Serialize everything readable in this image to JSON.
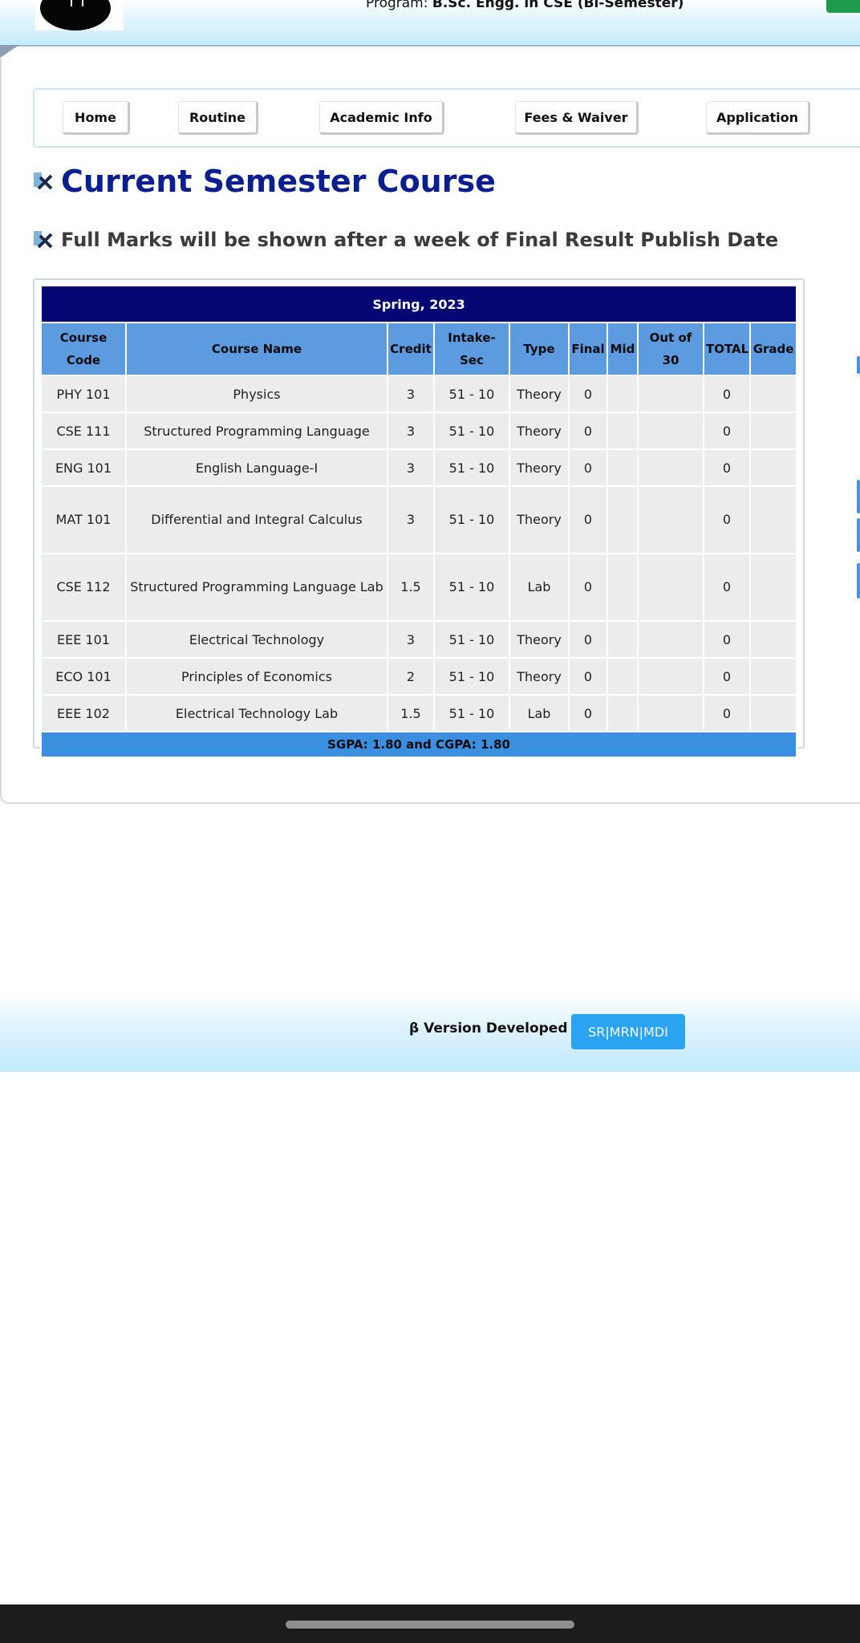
{
  "header": {
    "program_prefix": "Program:",
    "program_value": "B.Sc. Engg. in CSE (Bi-Semester)"
  },
  "nav": {
    "items": [
      {
        "label": "Home"
      },
      {
        "label": "Routine"
      },
      {
        "label": "Academic Info"
      },
      {
        "label": "Fees & Waiver"
      },
      {
        "label": "Application"
      }
    ]
  },
  "main": {
    "title": "Current Semester Course",
    "notice": "Full Marks will be shown after a week of Final Result Publish Date",
    "title_icon": "pen-ruler-icon",
    "notice_icon": "pen-ruler-icon"
  },
  "table": {
    "semester": "Spring, 2023",
    "headers": [
      "Course Code",
      "Course Name",
      "Credit",
      "Intake-Sec",
      "Type",
      "Final",
      "Mid",
      "Out of 30",
      "TOTAL",
      "Grade"
    ],
    "rows": [
      {
        "code": "PHY 101",
        "name": "Physics",
        "credit": "3",
        "intake": "51 - 10",
        "type": "Theory",
        "final": "0",
        "mid": "",
        "out30": "",
        "total": "0",
        "grade": ""
      },
      {
        "code": "CSE 111",
        "name": "Structured Programming Language",
        "credit": "3",
        "intake": "51 - 10",
        "type": "Theory",
        "final": "0",
        "mid": "",
        "out30": "",
        "total": "0",
        "grade": ""
      },
      {
        "code": "ENG 101",
        "name": "English Language-I",
        "credit": "3",
        "intake": "51 - 10",
        "type": "Theory",
        "final": "0",
        "mid": "",
        "out30": "",
        "total": "0",
        "grade": ""
      },
      {
        "code": "MAT 101",
        "name": "Differential and Integral Calculus",
        "credit": "3",
        "intake": "51 - 10",
        "type": "Theory",
        "final": "0",
        "mid": "",
        "out30": "",
        "total": "0",
        "grade": ""
      },
      {
        "code": "CSE 112",
        "name": "Structured Programming Language Lab",
        "credit": "1.5",
        "intake": "51 - 10",
        "type": "Lab",
        "final": "0",
        "mid": "",
        "out30": "",
        "total": "0",
        "grade": ""
      },
      {
        "code": "EEE 101",
        "name": "Electrical Technology",
        "credit": "3",
        "intake": "51 - 10",
        "type": "Theory",
        "final": "0",
        "mid": "",
        "out30": "",
        "total": "0",
        "grade": ""
      },
      {
        "code": "ECO 101",
        "name": "Principles of Economics",
        "credit": "2",
        "intake": "51 - 10",
        "type": "Theory",
        "final": "0",
        "mid": "",
        "out30": "",
        "total": "0",
        "grade": ""
      },
      {
        "code": "EEE 102",
        "name": "Electrical Technology Lab",
        "credit": "1.5",
        "intake": "51 - 10",
        "type": "Lab",
        "final": "0",
        "mid": "",
        "out30": "",
        "total": "0",
        "grade": ""
      }
    ],
    "summary": "SGPA: 1.80 and CGPA: 1.80"
  },
  "footer": {
    "text": "β Version Developed By",
    "badge": "SR|MRN|MDI"
  },
  "colors": {
    "title": "#0a1f8f",
    "semester_bg": "#050573",
    "header_bg": "#5c9be0",
    "summary_bg": "#3b8fe0",
    "badge_bg": "#2aa3f0"
  }
}
